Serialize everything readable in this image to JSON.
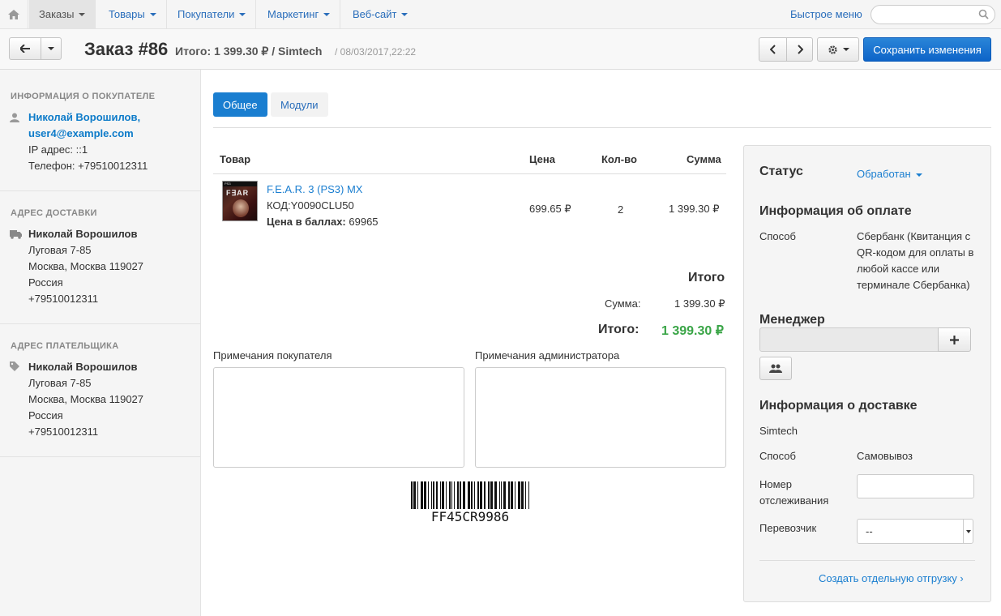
{
  "nav": {
    "items": [
      {
        "label": "Заказы"
      },
      {
        "label": "Товары"
      },
      {
        "label": "Покупатели"
      },
      {
        "label": "Маркетинг"
      },
      {
        "label": "Веб-сайт"
      }
    ],
    "quick_menu": "Быстрое меню",
    "search_placeholder": ""
  },
  "header": {
    "title": "Заказ #86",
    "total": "Итого: 1 399.30 ₽ / Simtech",
    "date": "/ 08/03/2017,22:22",
    "save_label": "Сохранить изменения"
  },
  "sidebar": {
    "customer": {
      "title": "Информация о покупателе",
      "name": "Николай Ворошилов,",
      "email": "user4@example.com",
      "ip": "IP адрес: ::1",
      "phone": "Телефон: +79510012311"
    },
    "shipping": {
      "title": "Адрес доставки",
      "name": "Николай Ворошилов",
      "street": "Луговая 7-85",
      "city": "Москва, Москва 119027",
      "country": "Россия",
      "phone": "+79510012311"
    },
    "billing": {
      "title": "Адрес плательщика",
      "name": "Николай Ворошилов",
      "street": "Луговая 7-85",
      "city": "Москва, Москва 119027",
      "country": "Россия",
      "phone": "+79510012311"
    }
  },
  "tabs": [
    {
      "label": "Общее"
    },
    {
      "label": "Модули"
    }
  ],
  "table": {
    "headers": {
      "product": "Товар",
      "price": "Цена",
      "qty": "Кол-во",
      "sum": "Сумма"
    },
    "rows": [
      {
        "name": "F.E.A.R. 3 (PS3) MX",
        "code": "КОД:Y0090CLU50",
        "points_label": "Цена в баллах:",
        "points": "69965",
        "price": "699.65 ₽",
        "qty": "2",
        "sum": "1 399.30 ₽",
        "image_text": "F∃AR"
      }
    ]
  },
  "totals": {
    "title": "Итого",
    "subtotal_label": "Сумма:",
    "subtotal": "1 399.30 ₽",
    "total_label": "Итого:",
    "total": "1 399.30 ₽"
  },
  "notes": {
    "customer_label": "Примечания покупателя",
    "admin_label": "Примечания администратора"
  },
  "barcode": "FF45CR9986",
  "panel": {
    "status_label": "Статус",
    "status_value": "Обработан",
    "payment_title": "Информация об оплате",
    "method_label": "Способ",
    "method_value": "Сбербанк (Квитанция с QR-кодом для оплаты в любой кассе или терминале Сбербанка)",
    "manager_title": "Менеджер",
    "shipping_title": "Информация о доставке",
    "shipping_company": "Simtech",
    "shipping_method_label": "Способ",
    "shipping_method_value": "Самовывоз",
    "tracking_label": "Номер отслеживания",
    "carrier_label": "Перевозчик",
    "carrier_value": "--",
    "create_shipment": "Создать отдельную отгрузку ›"
  },
  "colors": {
    "accent": "#1a7ed0",
    "link": "#0d7bc9",
    "total_green": "#3aa547"
  }
}
